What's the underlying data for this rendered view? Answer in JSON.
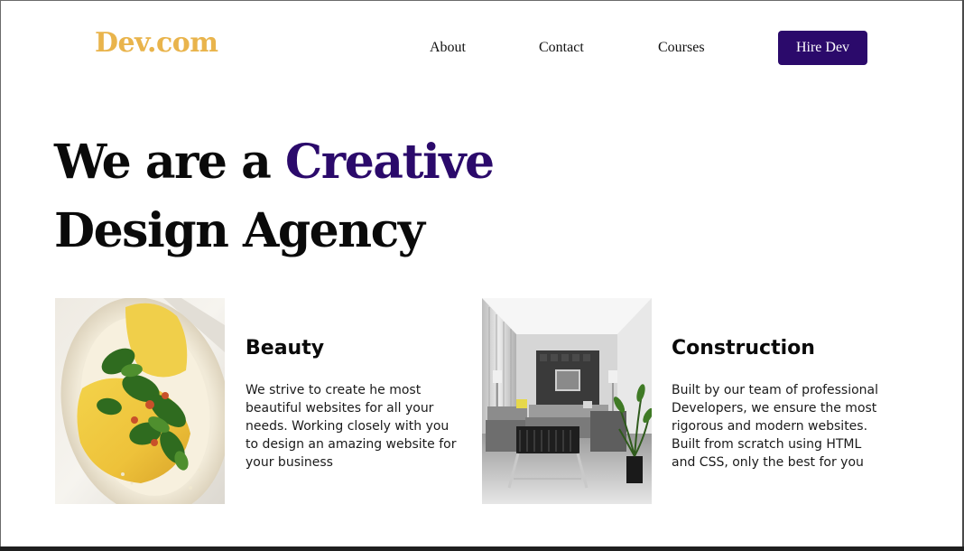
{
  "header": {
    "logo": "Dev.com",
    "nav": {
      "about": "About",
      "contact": "Contact",
      "courses": "Courses"
    },
    "cta": "Hire Dev"
  },
  "hero": {
    "line1_prefix": "We are a ",
    "line1_accent": "Creative",
    "line2": "Design Agency"
  },
  "cards": [
    {
      "image": "plated-omelette-with-greens-photo",
      "title": "Beauty",
      "text": "We strive to create he most beautiful websites for all your needs. Working closely with you to design an amazing website for your business"
    },
    {
      "image": "modern-living-room-interior-photo",
      "title": "Construction",
      "text": "Built by our team of professional Developers, we ensure the most rigorous and modern websites. Built from scratch using HTML and CSS, only the best for you"
    }
  ],
  "colors": {
    "brand_gold": "#e9b44c",
    "brand_purple": "#2b0a6b",
    "text": "#0a0a0a"
  }
}
